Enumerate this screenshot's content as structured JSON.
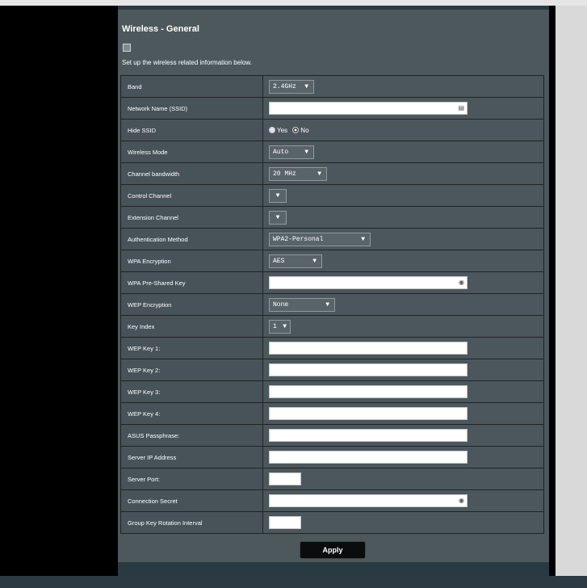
{
  "page": {
    "title": "Wireless - General",
    "description": "Set up the wireless related information below."
  },
  "fields": {
    "band": {
      "label": "Band",
      "value": "2.4GHz"
    },
    "ssid": {
      "label": "Network Name (SSID)",
      "value": ""
    },
    "hide_ssid": {
      "label": "Hide SSID",
      "option_yes": "Yes",
      "option_no": "No",
      "selected": "No"
    },
    "wireless_mode": {
      "label": "Wireless Mode",
      "value": "Auto"
    },
    "channel_bandwidth": {
      "label": "Channel bandwidth",
      "value": "20 MHz"
    },
    "control_channel": {
      "label": "Control Channel",
      "value": ""
    },
    "extension_channel": {
      "label": "Extension Channel",
      "value": ""
    },
    "auth_method": {
      "label": "Authentication Method",
      "value": "WPA2-Personal"
    },
    "wpa_encryption": {
      "label": "WPA Encryption",
      "value": "AES"
    },
    "wpa_psk": {
      "label": "WPA Pre-Shared Key",
      "value": ""
    },
    "wep_encryption": {
      "label": "WEP Encryption",
      "value": "None"
    },
    "key_index": {
      "label": "Key Index",
      "value": "1"
    },
    "wep_key1": {
      "label": "WEP Key 1:",
      "value": ""
    },
    "wep_key2": {
      "label": "WEP Key 2:",
      "value": ""
    },
    "wep_key3": {
      "label": "WEP Key 3:",
      "value": ""
    },
    "wep_key4": {
      "label": "WEP Key 4:",
      "value": ""
    },
    "asus_passphrase": {
      "label": "ASUS Passphrase:",
      "value": ""
    },
    "server_ip": {
      "label": "Server IP Address",
      "value": ""
    },
    "server_port": {
      "label": "Server Port:",
      "value": ""
    },
    "connection_secret": {
      "label": "Connection Secret",
      "value": ""
    },
    "group_key_interval": {
      "label": "Group Key Rotation Interval",
      "value": ""
    }
  },
  "actions": {
    "apply_label": "Apply"
  },
  "icons": {
    "dropdown": "chevron-down-icon",
    "id_card": "id-card-icon",
    "password_reveal": "eye-icon",
    "broken_image": "broken-image-icon"
  },
  "colors": {
    "panel": "#4d585d",
    "label_cell": "#475359",
    "value_cell": "#4b575d",
    "select_bg": "#596469",
    "apply_bg": "#0a0c0d"
  }
}
